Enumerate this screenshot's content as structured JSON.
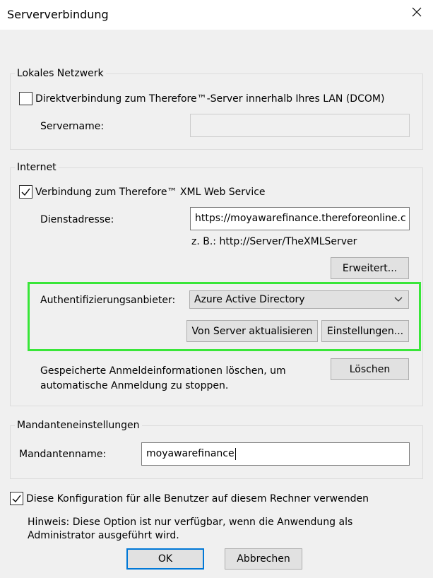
{
  "window": {
    "title": "Serververbindung"
  },
  "local_network": {
    "legend": "Lokales Netzwerk",
    "direct_connection_label": "Direktverbindung zum Therefore™-Server innerhalb Ihres LAN (DCOM)",
    "direct_connection_checked": false,
    "servername_label": "Servername:",
    "servername_value": ""
  },
  "internet": {
    "legend": "Internet",
    "xml_service_label": "Verbindung zum Therefore™ XML Web Service",
    "xml_service_checked": true,
    "service_address_label": "Dienstadresse:",
    "service_address_value": "https://moyawarefinance.thereforeonline.c",
    "example_hint": "z. B.: http://Server/TheXMLServer",
    "advanced_button": "Erweitert...",
    "auth_provider_label": "Authentifizierungsanbieter:",
    "auth_provider_selected": "Azure Active Directory",
    "refresh_button": "Von Server aktualisieren",
    "settings_button": "Einstellungen...",
    "clear_credentials_line1": "Gespeicherte Anmeldeinformationen löschen, um",
    "clear_credentials_line2": "automatische Anmeldung zu stoppen.",
    "delete_button": "Löschen"
  },
  "tenant": {
    "legend": "Mandanteneinstellungen",
    "tenant_name_label": "Mandantenname:",
    "tenant_name_value": "moyawarefinance"
  },
  "all_users": {
    "label": "Diese Konfiguration für alle Benutzer auf diesem Rechner verwenden",
    "checked": true,
    "hint_line1": "Hinweis: Diese Option ist nur verfügbar, wenn die Anwendung als",
    "hint_line2": "Administrator ausgeführt wird."
  },
  "footer": {
    "ok_button": "OK",
    "cancel_button": "Abbrechen"
  },
  "colors": {
    "highlight": "#39e639",
    "default_button_border": "#0078d7"
  }
}
